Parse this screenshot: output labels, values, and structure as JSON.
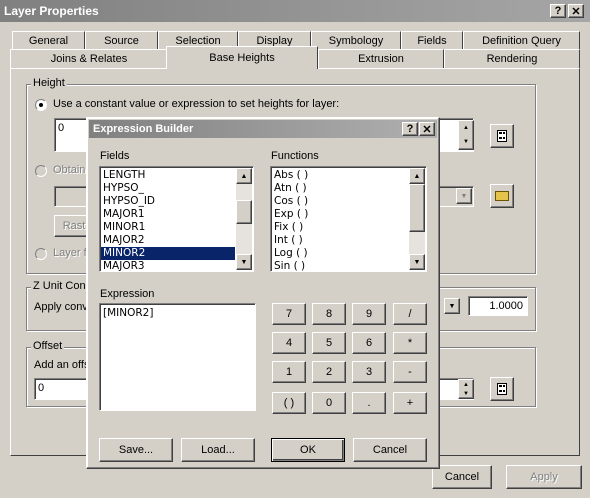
{
  "window": {
    "title": "Layer Properties",
    "help": "?",
    "close": "✕"
  },
  "tabs_row1": [
    "General",
    "Source",
    "Selection",
    "Display",
    "Symbology",
    "Fields",
    "Definition Query"
  ],
  "tabs_row2": [
    "Joins & Relates",
    "Base Heights",
    "Extrusion",
    "Rendering"
  ],
  "active_tab": "Base Heights",
  "height_group": {
    "label": "Height",
    "option1": "Use a constant value or expression to set heights for layer:",
    "value": "0",
    "option2": "Obtain",
    "raster_btn": "Rast",
    "option3": "Layer f"
  },
  "zunit_group": {
    "label": "Z Unit Con",
    "text": "Apply conv",
    "value": "1.0000"
  },
  "offset_group": {
    "label": "Offset",
    "text": "Add an offs",
    "value": "0"
  },
  "footer": {
    "cancel": "Cancel",
    "apply": "Apply"
  },
  "expr_builder": {
    "title": "Expression Builder",
    "help": "?",
    "close": "✕",
    "fields_label": "Fields",
    "fields": [
      "LENGTH",
      "HYPSO_",
      "HYPSO_ID",
      "MAJOR1",
      "MINOR1",
      "MAJOR2",
      "MINOR2",
      "MAJOR3"
    ],
    "selected_field": "MINOR2",
    "functions_label": "Functions",
    "functions": [
      "Abs ( )",
      "Atn ( )",
      "Cos ( )",
      "Exp ( )",
      "Fix ( )",
      "Int ( )",
      "Log ( )",
      "Sin ( )"
    ],
    "expression_label": "Expression",
    "expression": "[MINOR2]",
    "keypad": [
      [
        "7",
        "8",
        "9",
        "/"
      ],
      [
        "4",
        "5",
        "6",
        "*"
      ],
      [
        "1",
        "2",
        "3",
        "-"
      ],
      [
        "( )",
        "0",
        ".",
        "+"
      ]
    ],
    "buttons": {
      "save": "Save...",
      "load": "Load...",
      "ok": "OK",
      "cancel": "Cancel"
    }
  }
}
